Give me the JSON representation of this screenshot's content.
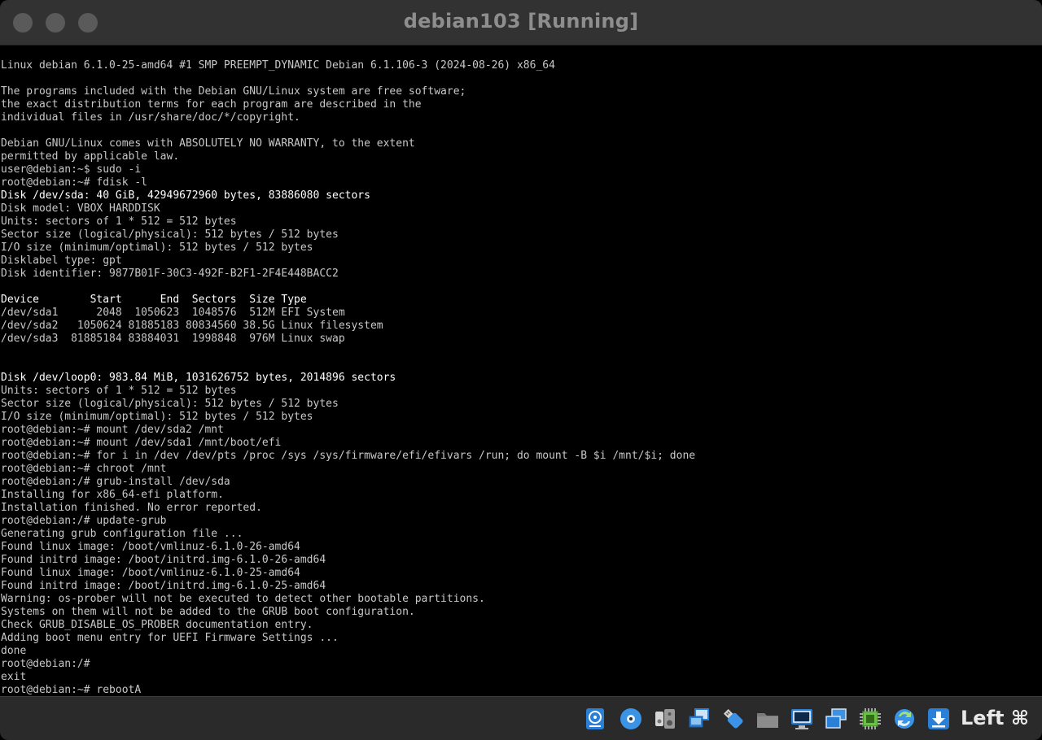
{
  "window": {
    "title": "debian103 [Running]"
  },
  "console": {
    "lines": [
      {
        "text": "Linux debian 6.1.0-25-amd64 #1 SMP PREEMPT_DYNAMIC Debian 6.1.106-3 (2024-08-26) x86_64",
        "bright": false
      },
      {
        "text": "",
        "bright": false
      },
      {
        "text": "The programs included with the Debian GNU/Linux system are free software;",
        "bright": false
      },
      {
        "text": "the exact distribution terms for each program are described in the",
        "bright": false
      },
      {
        "text": "individual files in /usr/share/doc/*/copyright.",
        "bright": false
      },
      {
        "text": "",
        "bright": false
      },
      {
        "text": "Debian GNU/Linux comes with ABSOLUTELY NO WARRANTY, to the extent",
        "bright": false
      },
      {
        "text": "permitted by applicable law.",
        "bright": false
      },
      {
        "text": "user@debian:~$ sudo -i",
        "bright": false
      },
      {
        "text": "root@debian:~# fdisk -l",
        "bright": false
      },
      {
        "text": "Disk /dev/sda: 40 GiB, 42949672960 bytes, 83886080 sectors",
        "bright": true
      },
      {
        "text": "Disk model: VBOX HARDDISK",
        "bright": false
      },
      {
        "text": "Units: sectors of 1 * 512 = 512 bytes",
        "bright": false
      },
      {
        "text": "Sector size (logical/physical): 512 bytes / 512 bytes",
        "bright": false
      },
      {
        "text": "I/O size (minimum/optimal): 512 bytes / 512 bytes",
        "bright": false
      },
      {
        "text": "Disklabel type: gpt",
        "bright": false
      },
      {
        "text": "Disk identifier: 9877B01F-30C3-492F-B2F1-2F4E448BACC2",
        "bright": false
      },
      {
        "text": "",
        "bright": false
      },
      {
        "text": "Device        Start      End  Sectors  Size Type",
        "bright": true
      },
      {
        "text": "/dev/sda1      2048  1050623  1048576  512M EFI System",
        "bright": false
      },
      {
        "text": "/dev/sda2   1050624 81885183 80834560 38.5G Linux filesystem",
        "bright": false
      },
      {
        "text": "/dev/sda3  81885184 83884031  1998848  976M Linux swap",
        "bright": false
      },
      {
        "text": "",
        "bright": false
      },
      {
        "text": "",
        "bright": false
      },
      {
        "text": "Disk /dev/loop0: 983.84 MiB, 1031626752 bytes, 2014896 sectors",
        "bright": true
      },
      {
        "text": "Units: sectors of 1 * 512 = 512 bytes",
        "bright": false
      },
      {
        "text": "Sector size (logical/physical): 512 bytes / 512 bytes",
        "bright": false
      },
      {
        "text": "I/O size (minimum/optimal): 512 bytes / 512 bytes",
        "bright": false
      },
      {
        "text": "root@debian:~# mount /dev/sda2 /mnt",
        "bright": false
      },
      {
        "text": "root@debian:~# mount /dev/sda1 /mnt/boot/efi",
        "bright": false
      },
      {
        "text": "root@debian:~# for i in /dev /dev/pts /proc /sys /sys/firmware/efi/efivars /run; do mount -B $i /mnt/$i; done",
        "bright": false
      },
      {
        "text": "root@debian:~# chroot /mnt",
        "bright": false
      },
      {
        "text": "root@debian:/# grub-install /dev/sda",
        "bright": false
      },
      {
        "text": "Installing for x86_64-efi platform.",
        "bright": false
      },
      {
        "text": "Installation finished. No error reported.",
        "bright": false
      },
      {
        "text": "root@debian:/# update-grub",
        "bright": false
      },
      {
        "text": "Generating grub configuration file ...",
        "bright": false
      },
      {
        "text": "Found linux image: /boot/vmlinuz-6.1.0-26-amd64",
        "bright": false
      },
      {
        "text": "Found initrd image: /boot/initrd.img-6.1.0-26-amd64",
        "bright": false
      },
      {
        "text": "Found linux image: /boot/vmlinuz-6.1.0-25-amd64",
        "bright": false
      },
      {
        "text": "Found initrd image: /boot/initrd.img-6.1.0-25-amd64",
        "bright": false
      },
      {
        "text": "Warning: os-prober will not be executed to detect other bootable partitions.",
        "bright": false
      },
      {
        "text": "Systems on them will not be added to the GRUB boot configuration.",
        "bright": false
      },
      {
        "text": "Check GRUB_DISABLE_OS_PROBER documentation entry.",
        "bright": false
      },
      {
        "text": "Adding boot menu entry for UEFI Firmware Settings ...",
        "bright": false
      },
      {
        "text": "done",
        "bright": false
      },
      {
        "text": "root@debian:/#",
        "bright": false
      },
      {
        "text": "exit",
        "bright": false
      },
      {
        "text": "root@debian:~# rebootA",
        "bright": false
      }
    ]
  },
  "statusbar": {
    "icons": [
      "hard-disk-icon",
      "optical-drive-icon",
      "audio-icon",
      "network-icon",
      "usb-icon",
      "shared-folders-icon",
      "display-icon",
      "recording-icon",
      "cpu-icon",
      "mouse-integration-icon",
      "download-icon"
    ],
    "host_key": "Left ⌘"
  },
  "colors": {
    "titlebar": "#323232",
    "console_bg": "#000000",
    "console_text": "#c8c8c8",
    "statusbar": "#2a2a2a",
    "accent_blue": "#2a7fd6"
  }
}
